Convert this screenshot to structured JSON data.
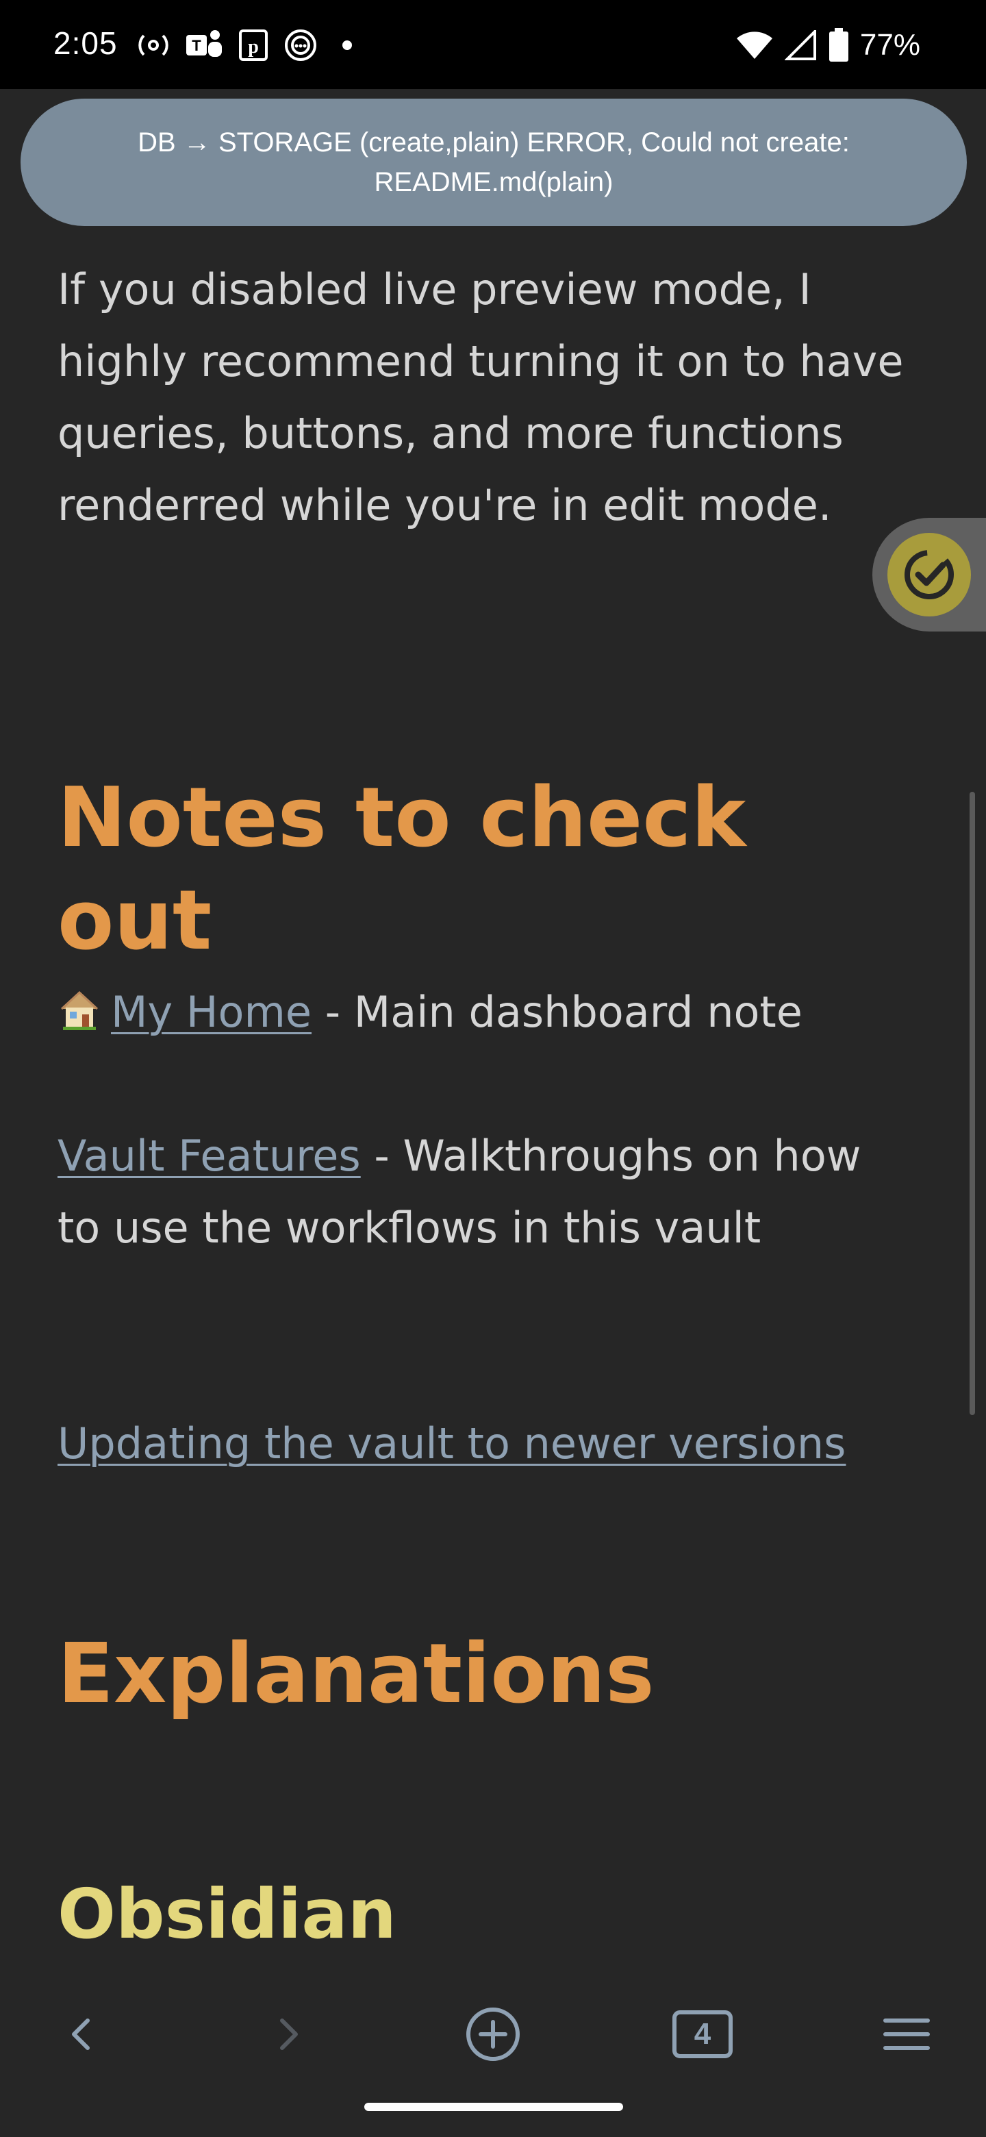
{
  "status_bar": {
    "time": "2:05",
    "battery": "77%"
  },
  "toast": {
    "message": "DB → STORAGE (create,plain) ERROR, Could not create: README.md(plain)"
  },
  "content": {
    "intro_paragraph": "If you disabled live preview mode, I highly recommend turning it on to have queries, buttons, and more functions renderred while you're in edit mode.",
    "section1_heading": "Notes to check out",
    "links": [
      {
        "label": "My Home",
        "suffix": " - Main dashboard note"
      },
      {
        "label": "Vault Features",
        "suffix": " - Walkthroughs on how to use the workflows in this vault"
      },
      {
        "label": "Updating the vault to newer versions",
        "suffix": ""
      }
    ],
    "section2_heading": "Explanations",
    "subheading": "Obsidian"
  },
  "bottom_nav": {
    "tab_count": "4"
  },
  "colors": {
    "background": "#262626",
    "heading": "#e3984a",
    "subheading": "#e3d77d",
    "link": "#8fa1b3",
    "toast": "#7b8c9b"
  }
}
